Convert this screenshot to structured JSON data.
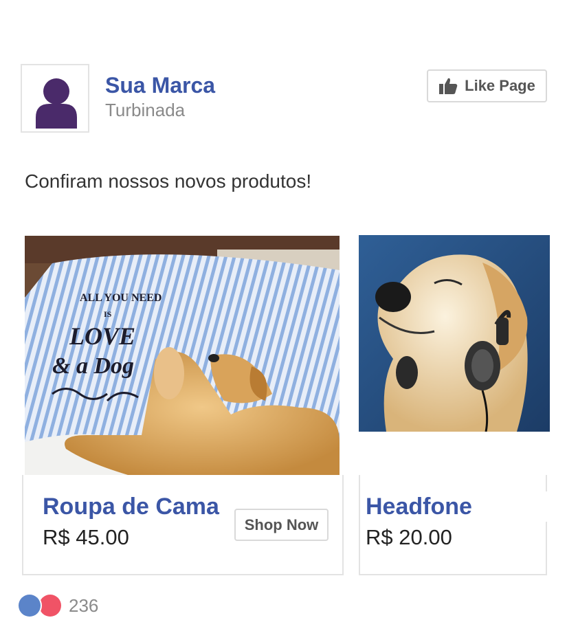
{
  "header": {
    "brand_name": "Sua Marca",
    "brand_subtitle": "Turbinada",
    "like_button_label": "Like Page",
    "avatar_icon": "person-icon",
    "avatar_color": "#4a2a6a"
  },
  "post": {
    "text": "Confiram nossos novos produtos!"
  },
  "carousel": {
    "items": [
      {
        "title": "Roupa de Cama",
        "price": "R$ 45.00",
        "button_label": "Shop Now",
        "image_text": [
          "ALL YOU NEED",
          "IS",
          "LOVE",
          "& a Dog"
        ]
      },
      {
        "title": "Headfone",
        "price": "R$ 20.00"
      }
    ]
  },
  "reactions": {
    "count": "236",
    "colors": [
      "#5b84c9",
      "#f05366"
    ]
  },
  "colors": {
    "brand_blue": "#3b56a6",
    "border": "#e3e3e3"
  }
}
